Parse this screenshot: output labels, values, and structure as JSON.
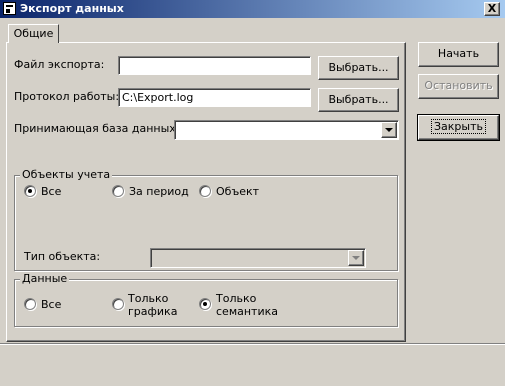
{
  "window": {
    "title": "Экспорт данных",
    "close_label": "X"
  },
  "tabs": [
    {
      "label": "Общие"
    }
  ],
  "fields": {
    "export_file": {
      "label": "Файл экспорта:",
      "value": ""
    },
    "log": {
      "label": "Протокол работы:",
      "value": "C:\\Export.log"
    },
    "target_db": {
      "label": "Принимающая база данных:",
      "value": ""
    }
  },
  "browse_label": "Выбрать...",
  "objects_group": {
    "title": "Объекты учета",
    "options": [
      "Все",
      "За период",
      "Объект"
    ],
    "selected": "Все",
    "type_label": "Тип объекта:",
    "type_value": ""
  },
  "data_group": {
    "title": "Данные",
    "options": [
      "Все",
      "Только графика",
      "Только семантика"
    ],
    "option_lines": [
      [
        "Все"
      ],
      [
        "Только",
        "графика"
      ],
      [
        "Только",
        "семантика"
      ]
    ],
    "selected": "Только семантика"
  },
  "buttons": {
    "start": "Начать",
    "stop": "Остановить",
    "close": "Закрыть"
  }
}
